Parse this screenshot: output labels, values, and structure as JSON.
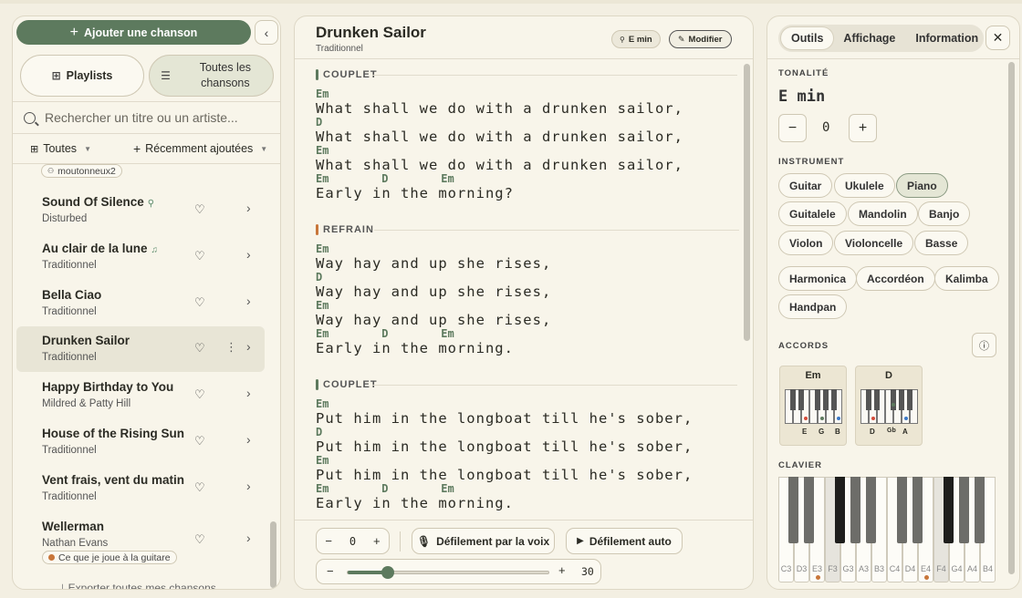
{
  "sidebar": {
    "add_song_label": "Ajouter une chanson",
    "collapse_icon": "chevron-left-icon",
    "tabs": {
      "playlists": "Playlists",
      "all_songs": "Toutes les chansons"
    },
    "search_placeholder": "Rechercher un titre ou un artiste...",
    "filter_all": "Toutes",
    "filter_recent": "Récemment ajoutées",
    "top_chip": "moutonneux2",
    "songs": [
      {
        "title": "Sound Of Silence",
        "artist": "Disturbed",
        "mark": "person-icon"
      },
      {
        "title": "Au clair de la lune",
        "artist": "Traditionnel",
        "mark": "music-note-icon"
      },
      {
        "title": "Bella Ciao",
        "artist": "Traditionnel"
      },
      {
        "title": "Drunken Sailor",
        "artist": "Traditionnel",
        "active": true
      },
      {
        "title": "Happy Birthday to You",
        "artist": "Mildred & Patty Hill"
      },
      {
        "title": "House of the Rising Sun",
        "artist": "Traditionnel"
      },
      {
        "title": "Vent frais, vent du matin",
        "artist": "Traditionnel"
      },
      {
        "title": "Wellerman",
        "artist": "Nathan Evans",
        "chip": "Ce que je joue à la guitare"
      }
    ],
    "export_label": "Exporter toutes mes chansons"
  },
  "song": {
    "title": "Drunken Sailor",
    "subtitle": "Traditionnel",
    "key_badge": "E min",
    "edit_label": "Modifier",
    "sections": [
      {
        "label": "COUPLET",
        "color": "#5d7a5e",
        "lines": [
          {
            "chords": "Em",
            "text": "What shall we do with a drunken sailor,"
          },
          {
            "chords": "D",
            "text": "What shall we do with a drunken sailor,"
          },
          {
            "chords": "Em",
            "text": "What shall we do with a drunken sailor,"
          },
          {
            "chords": "Em        D        Em",
            "text": "Early in the morning?"
          }
        ]
      },
      {
        "label": "REFRAIN",
        "color": "#c8763a",
        "lines": [
          {
            "chords": "Em",
            "text": "Way hay and up she rises,"
          },
          {
            "chords": "D",
            "text": "Way hay and up she rises,"
          },
          {
            "chords": "Em",
            "text": "Way hay and up she rises,"
          },
          {
            "chords": "Em        D        Em",
            "text": "Early in the morning."
          }
        ]
      },
      {
        "label": "COUPLET",
        "color": "#5d7a5e",
        "lines": [
          {
            "chords": "Em",
            "text": "Put him in the longboat till he's sober,"
          },
          {
            "chords": "D",
            "text": "Put him in the longboat till he's sober,"
          },
          {
            "chords": "Em",
            "text": "Put him in the longboat till he's sober,"
          },
          {
            "chords": "Em        D        Em",
            "text": "Early in the morning."
          }
        ]
      }
    ]
  },
  "controls": {
    "transpose_value": "0",
    "voice_scroll_label": "Défilement par la voix",
    "auto_scroll_label": "Défilement auto",
    "speed_value": "30",
    "speed_level": 0.2
  },
  "tools": {
    "tabs": [
      "Outils",
      "Affichage",
      "Information"
    ],
    "active_tab": "Outils",
    "key_label": "TONALITÉ",
    "key_value": "E min",
    "transpose_value": "0",
    "instrument_label": "INSTRUMENT",
    "instruments": [
      "Guitar",
      "Ukulele",
      "Piano",
      "Guitalele",
      "Mandolin",
      "Banjo",
      "Violon",
      "Violoncelle",
      "Basse",
      "Harmonica",
      "Accordéon",
      "Kalimba",
      "Handpan"
    ],
    "selected_instrument": "Piano",
    "chords_label": "ACCORDS",
    "chords": [
      {
        "name": "Em",
        "notes": [
          "E",
          "G",
          "B"
        ]
      },
      {
        "name": "D",
        "notes": [
          "D",
          "Gb",
          "A"
        ]
      }
    ],
    "keyboard_label": "CLAVIER",
    "keyboard_keys": [
      "C3",
      "D3",
      "E3",
      "F3",
      "G3",
      "A3",
      "B3",
      "C4",
      "D4",
      "E4",
      "F4",
      "G4",
      "A4",
      "B4"
    ]
  }
}
